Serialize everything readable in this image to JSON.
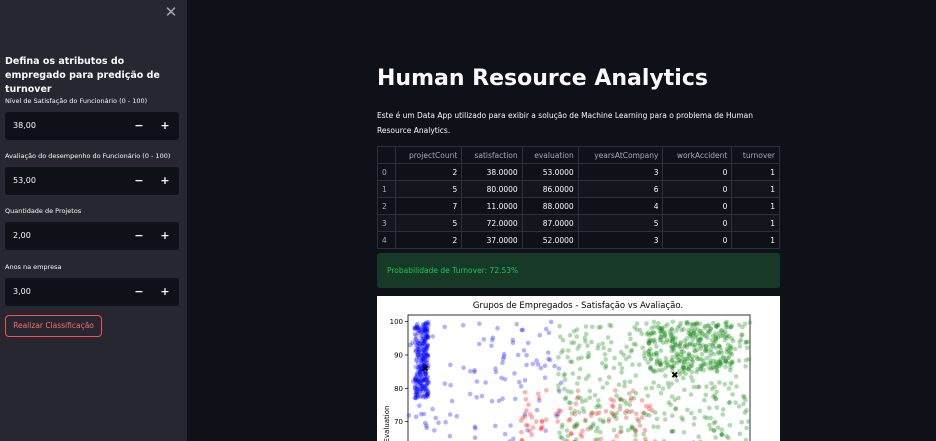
{
  "sidebar": {
    "close_icon": "close-icon",
    "heading": "Defina os atributos do empregado para predição de turnover",
    "fields": [
      {
        "label": "Nível de Satisfação do Funcionário (0 - 100)",
        "value": "38,00"
      },
      {
        "label": "Avaliação do desempenho do Funcionário (0 - 100)",
        "value": "53,00"
      },
      {
        "label": "Quantidade de Projetos",
        "value": "2,00"
      },
      {
        "label": "Anos na empresa",
        "value": "3,00"
      }
    ],
    "minus_label": "−",
    "plus_label": "+",
    "button_label": "Realizar Classificação"
  },
  "main": {
    "title": "Human Resource Analytics",
    "description": "Este é um Data App utilizado para exibir a solução de Machine Learning para o problema de Human Resource Analytics.",
    "table": {
      "columns": [
        "",
        "projectCount",
        "satisfaction",
        "evaluation",
        "yearsAtCompany",
        "workAccident",
        "turnover"
      ],
      "rows": [
        [
          "0",
          "2",
          "38.0000",
          "53.0000",
          "3",
          "0",
          "1"
        ],
        [
          "1",
          "5",
          "80.0000",
          "86.0000",
          "6",
          "0",
          "1"
        ],
        [
          "2",
          "7",
          "11.0000",
          "88.0000",
          "4",
          "0",
          "1"
        ],
        [
          "3",
          "5",
          "72.0000",
          "87.0000",
          "5",
          "0",
          "1"
        ],
        [
          "4",
          "2",
          "37.0000",
          "52.0000",
          "3",
          "0",
          "1"
        ]
      ]
    },
    "result": "Probabilidade de Turnover: 72.53%"
  },
  "chart_data": {
    "type": "scatter",
    "title": "Grupos de Empregados - Satisfação vs Avaliação.",
    "xlabel": "",
    "ylabel": "Evaluation",
    "yticks": [
      "100",
      "90",
      "80",
      "70"
    ],
    "ylim": [
      60,
      102
    ],
    "xlim": [
      0,
      1
    ],
    "series": [
      {
        "color": "#0000ff",
        "clusters": [
          {
            "x": [
              0.02,
              0.06
            ],
            "y": [
              77,
              100
            ],
            "count": 260
          },
          {
            "x": [
              0.0,
              0.45
            ],
            "y": [
              60,
              100
            ],
            "count": 120
          }
        ]
      },
      {
        "color": "#ff0000",
        "clusters": [
          {
            "x": [
              0.33,
              0.73
            ],
            "y": [
              60,
              80
            ],
            "count": 110
          }
        ]
      },
      {
        "color": "#008000",
        "clusters": [
          {
            "x": [
              0.44,
              1.0
            ],
            "y": [
              60,
              100
            ],
            "count": 420
          },
          {
            "x": [
              0.7,
              0.95
            ],
            "y": [
              85,
              100
            ],
            "count": 260
          }
        ]
      }
    ],
    "centroids": [
      {
        "x": 0.05,
        "y": 86
      },
      {
        "x": 0.78,
        "y": 84
      }
    ]
  }
}
